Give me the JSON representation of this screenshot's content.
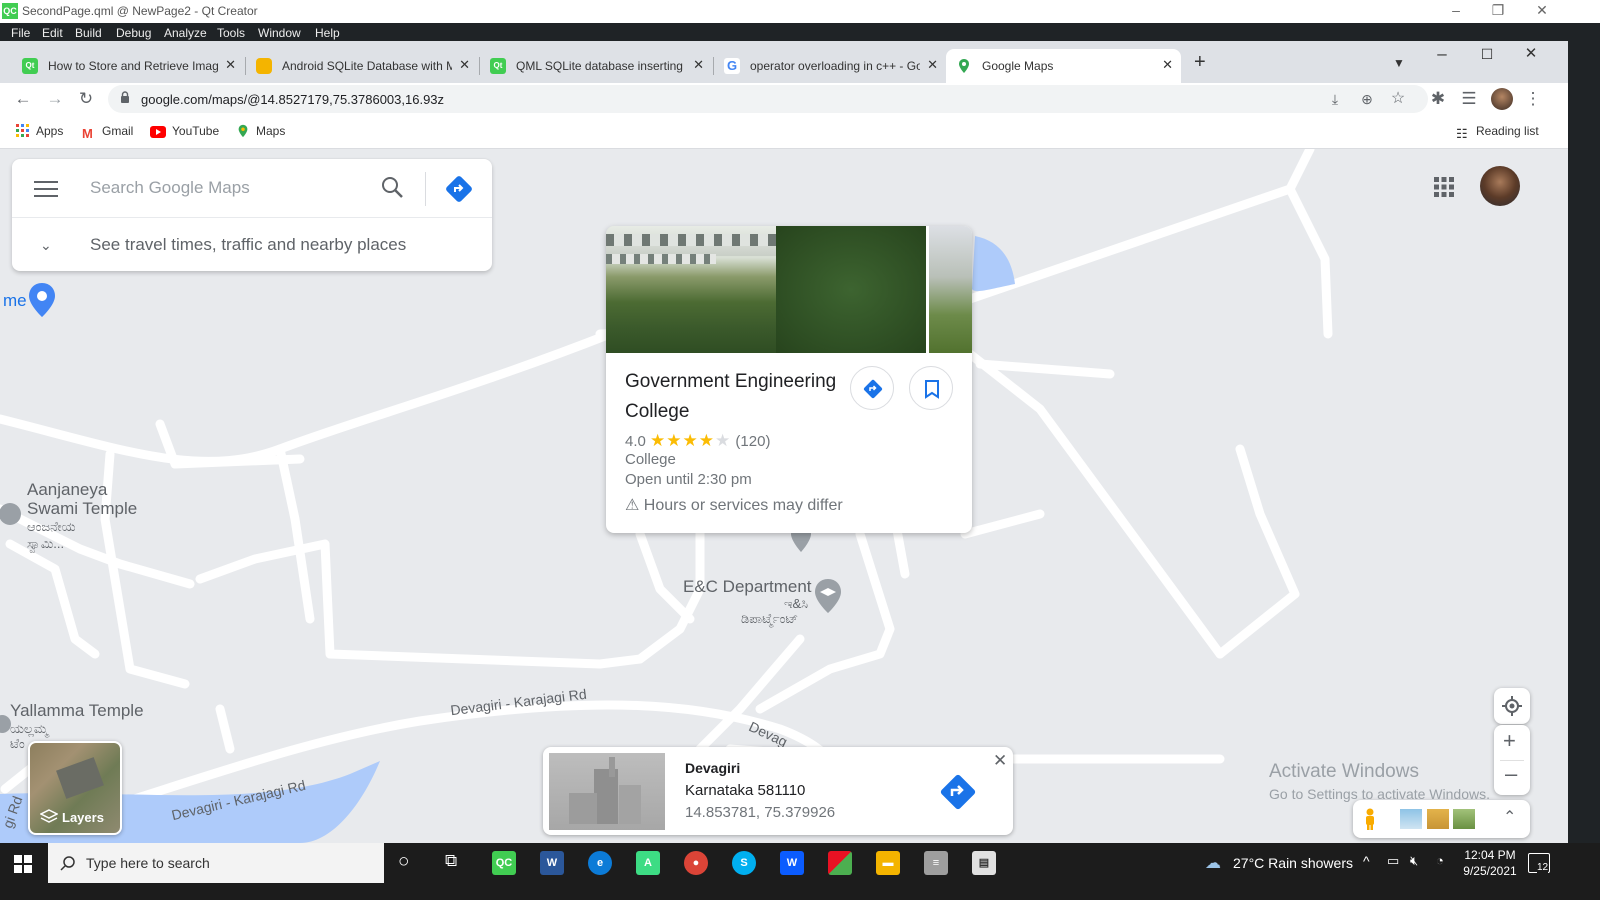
{
  "window": {
    "title": "SecondPage.qml @ NewPage2 - Qt Creator",
    "app_icon": "QC",
    "menu": [
      "File",
      "Edit",
      "Build",
      "Debug",
      "Analyze",
      "Tools",
      "Window",
      "Help"
    ]
  },
  "browser": {
    "tabs": [
      {
        "label": "How to Store and Retrieve Image",
        "icon": "qt-icon",
        "icon_text": "Qt",
        "color": "#41cd52"
      },
      {
        "label": "Android SQLite Database with M",
        "icon": "android-db-icon",
        "icon_text": "",
        "color": "#f4b400"
      },
      {
        "label": "QML SQLite database inserting r",
        "icon": "qt-icon",
        "icon_text": "Qt",
        "color": "#41cd52"
      },
      {
        "label": "operator overloading in c++ - Go",
        "icon": "google-icon",
        "icon_text": "G",
        "color": "#4285f4"
      },
      {
        "label": "Google Maps",
        "icon": "google-maps-icon",
        "icon_text": "",
        "color": "#34a853",
        "active": true
      }
    ],
    "new_tab": "+",
    "url": "google.com/maps/@14.8527179,75.3786003,16.93z",
    "bookmarks": [
      "Apps",
      "Gmail",
      "YouTube",
      "Maps"
    ],
    "reading_list": "Reading list"
  },
  "map": {
    "search": {
      "placeholder": "Search Google Maps",
      "value": ""
    },
    "travel_hint": "See travel times, traffic and nearby places",
    "labels": {
      "me_partial": "me",
      "aanjaneya_1": "Aanjaneya",
      "aanjaneya_2": "Swami Temple",
      "aanjaneya_kn1": "ಆಂಜನೇಯ",
      "aanjaneya_kn2": "ಸ್ವಾಮಿ...",
      "ec_dept": "E&C Department",
      "ec_kn1": "ಇ&ಸಿ",
      "ec_kn2": "ಡಿಪಾರ್ಟ್ಮೆಂಟ್",
      "yallamma": "Yallamma Temple",
      "yallamma_kn1": "ಯಲ್ಲಮ್ಮ",
      "yallamma_kn2": "ಟೆಂ",
      "road1": "Devagiri - Karajagi Rd",
      "road2": "Devagiri - Karajagi Rd",
      "road3": "Devag",
      "road4": "gi Rd"
    },
    "place": {
      "name": "Government Engineering College",
      "rating": "4.0",
      "stars_full": "★★★★",
      "stars_empty": "★",
      "reviews": "(120)",
      "category": "College",
      "hours": "Open until 2:30 pm",
      "warning": "Hours or services may differ"
    },
    "info": {
      "title": "Devagiri",
      "address": "Karnataka 581110",
      "coords": "14.853781, 75.379926"
    },
    "layers_label": "Layers",
    "watermark": {
      "title": "Activate Windows",
      "subtitle": "Go to Settings to activate Windows."
    }
  },
  "taskbar": {
    "search_placeholder": "Type here to search",
    "weather": "27°C  Rain showers",
    "time": "12:04 PM",
    "date": "9/25/2021",
    "notifications": "12"
  },
  "colors": {
    "map_bg": "#e8eaed",
    "road": "#ffffff",
    "water": "#aecbfa",
    "accent": "#1a73e8",
    "star": "#fbbc04",
    "taskbar": "#1c1c1c"
  }
}
